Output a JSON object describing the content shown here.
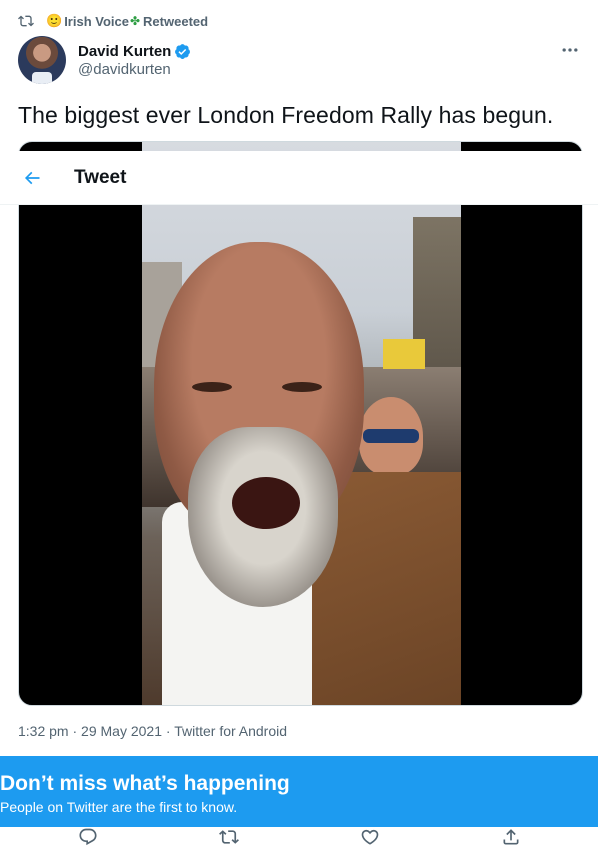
{
  "retweet": {
    "emoji": "🙂",
    "name": "Irish Voice",
    "shamrock": "✤",
    "label": "Retweeted"
  },
  "author": {
    "display_name": "David Kurten",
    "handle": "@davidkurten",
    "verified": true
  },
  "tweet": {
    "text": "The biggest ever London Freedom Rally has begun."
  },
  "topbar": {
    "title": "Tweet"
  },
  "meta": {
    "time": "1:32 pm",
    "sep1": " · ",
    "date": "29 May 2021",
    "sep2": " · ",
    "source": "Twitter for Android"
  },
  "banner": {
    "title": "Don’t miss what’s happening",
    "subtitle": "People on Twitter are the first to know."
  },
  "colors": {
    "accent": "#1d9bf0",
    "text": "#0f1419",
    "secondary": "#536471"
  },
  "icons": [
    "retweet-icon",
    "verified-badge-icon",
    "more-icon",
    "back-arrow-icon",
    "reply-icon",
    "retweet-action-icon",
    "like-icon",
    "share-icon"
  ]
}
